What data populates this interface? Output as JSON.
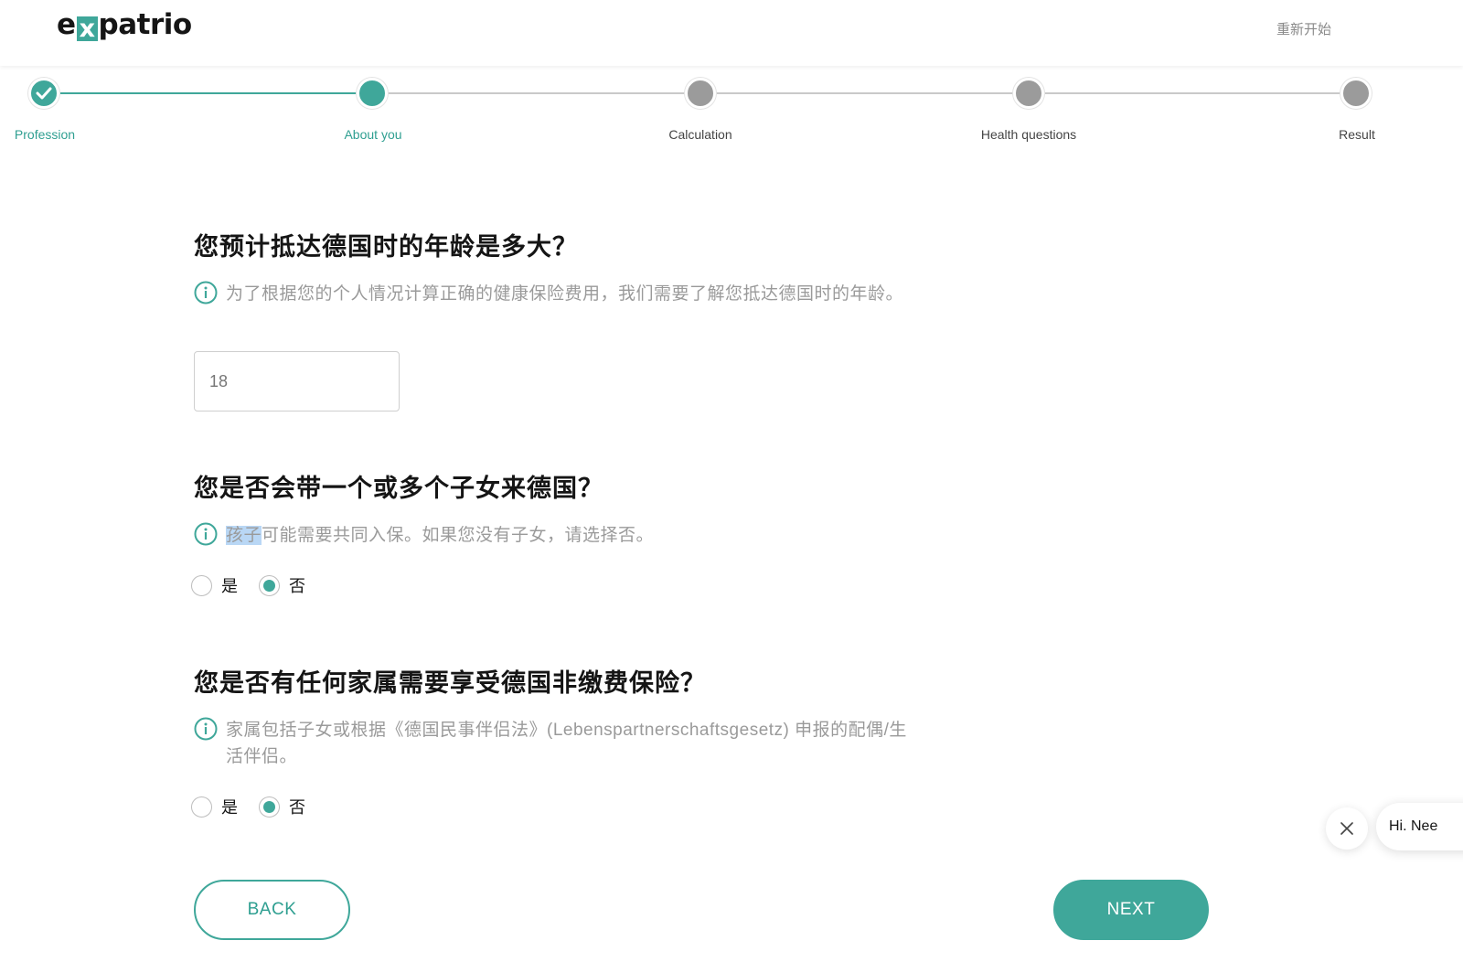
{
  "header": {
    "logo_prefix": "e",
    "logo_x": "x",
    "logo_suffix": "patrio",
    "restart_label": "重新开始"
  },
  "stepper": {
    "steps": [
      {
        "label": "Profession",
        "state": "done"
      },
      {
        "label": "About you",
        "state": "active"
      },
      {
        "label": "Calculation",
        "state": "pending"
      },
      {
        "label": "Health questions",
        "state": "pending"
      },
      {
        "label": "Result",
        "state": "pending"
      }
    ]
  },
  "questions": {
    "age": {
      "title": "您预计抵达德国时的年龄是多大？",
      "hint": "为了根据您的个人情况计算正确的健康保险费用，我们需要了解您抵达德国时的年龄。",
      "value": "18"
    },
    "children": {
      "title": "您是否会带一个或多个子女来德国？",
      "hint_highlight": "孩子",
      "hint_rest": "可能需要共同入保。如果您没有子女，请选择否。",
      "options": [
        "是",
        "否"
      ],
      "selected": "否"
    },
    "dependents": {
      "title": "您是否有任何家属需要享受德国非缴费保险？",
      "hint": "家属包括子女或根据《德国民事伴侣法》(Lebenspartnerschaftsgesetz) 申报的配偶/生活伴侣。",
      "options": [
        "是",
        "否"
      ],
      "selected": "否"
    }
  },
  "buttons": {
    "back_label": "BACK",
    "next_label": "NEXT"
  },
  "chat": {
    "greeting": "Hi. Nee"
  },
  "colors": {
    "accent": "#3fa79a",
    "pending_step": "#9b9b9b",
    "hint_text": "#9a9a9a"
  }
}
